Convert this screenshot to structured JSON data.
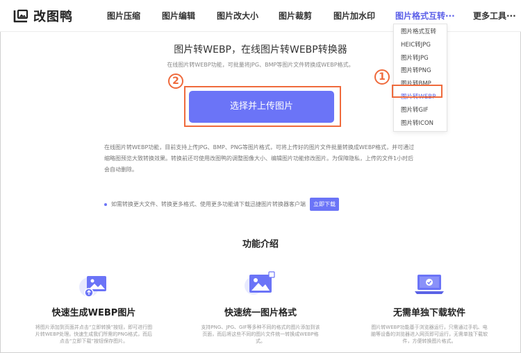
{
  "header": {
    "logo_text": "改图鸭",
    "nav": [
      {
        "label": "图片压缩"
      },
      {
        "label": "图片编辑"
      },
      {
        "label": "图片改大小"
      },
      {
        "label": "图片裁剪"
      },
      {
        "label": "图片加水印"
      },
      {
        "label": "图片格式互转···"
      },
      {
        "label": "更多工具···"
      }
    ]
  },
  "dropdown": {
    "items": [
      {
        "label": "图片格式互转"
      },
      {
        "label": "HEIC转JPG"
      },
      {
        "label": "图片转JPG"
      },
      {
        "label": "图片转PNG"
      },
      {
        "label": "图片转BMP"
      },
      {
        "label": "图片转WEBP"
      },
      {
        "label": "图片转GIF"
      },
      {
        "label": "图片转ICON"
      }
    ]
  },
  "callouts": {
    "one": "1",
    "two": "2"
  },
  "hero": {
    "title": "图片转WEBP，在线图片转WEBP转换器",
    "subtitle": "在线图片转WEBP功能，可批量将JPG、BMP等图片文件转换成WEBP格式。",
    "upload_label": "选择并上传图片"
  },
  "description": "在线图片转WEBP功能，目前支持上传JPG、BMP、PNG等图片格式，可将上传好的图片文件批量转换成WEBP格式，并可通过缩略图预览大致转换效果。转换前还可使用改图鸭的调整图像大小、编辑图片功能修改图片。为保障隐私，上传的文件1小时后会自动删除。",
  "notice": {
    "text": "如需转换更大文件、转换更多格式、使用更多功能请下载迅捷图片转换器客户端",
    "button": "立即下载"
  },
  "features": {
    "title": "功能介绍",
    "items": [
      {
        "title": "快速生成WEBP图片",
        "desc": "将图片添加到页面并点击“立即转换”按钮，即可进行图片转WEBP处理。快速生成我们所需的PNG格式，而后点击“立即下载”按钮保存图片。"
      },
      {
        "title": "快速统一图片格式",
        "desc": "支持PNG、JPG、GIF等多种不同的格式的图片添加到该页面，而后将这些不同的图片文件统一转换成WEBP格式。"
      },
      {
        "title": "无需单独下载软件",
        "desc": "图片转WEBP功能基于浏览器运行，只需通过手机、电脑等设备的浏览器进入网页即可运行，无需单独下载软件，方便转换图片格式。"
      }
    ]
  },
  "colors": {
    "accent": "#6b74f7",
    "highlight": "#ef6a3c"
  }
}
